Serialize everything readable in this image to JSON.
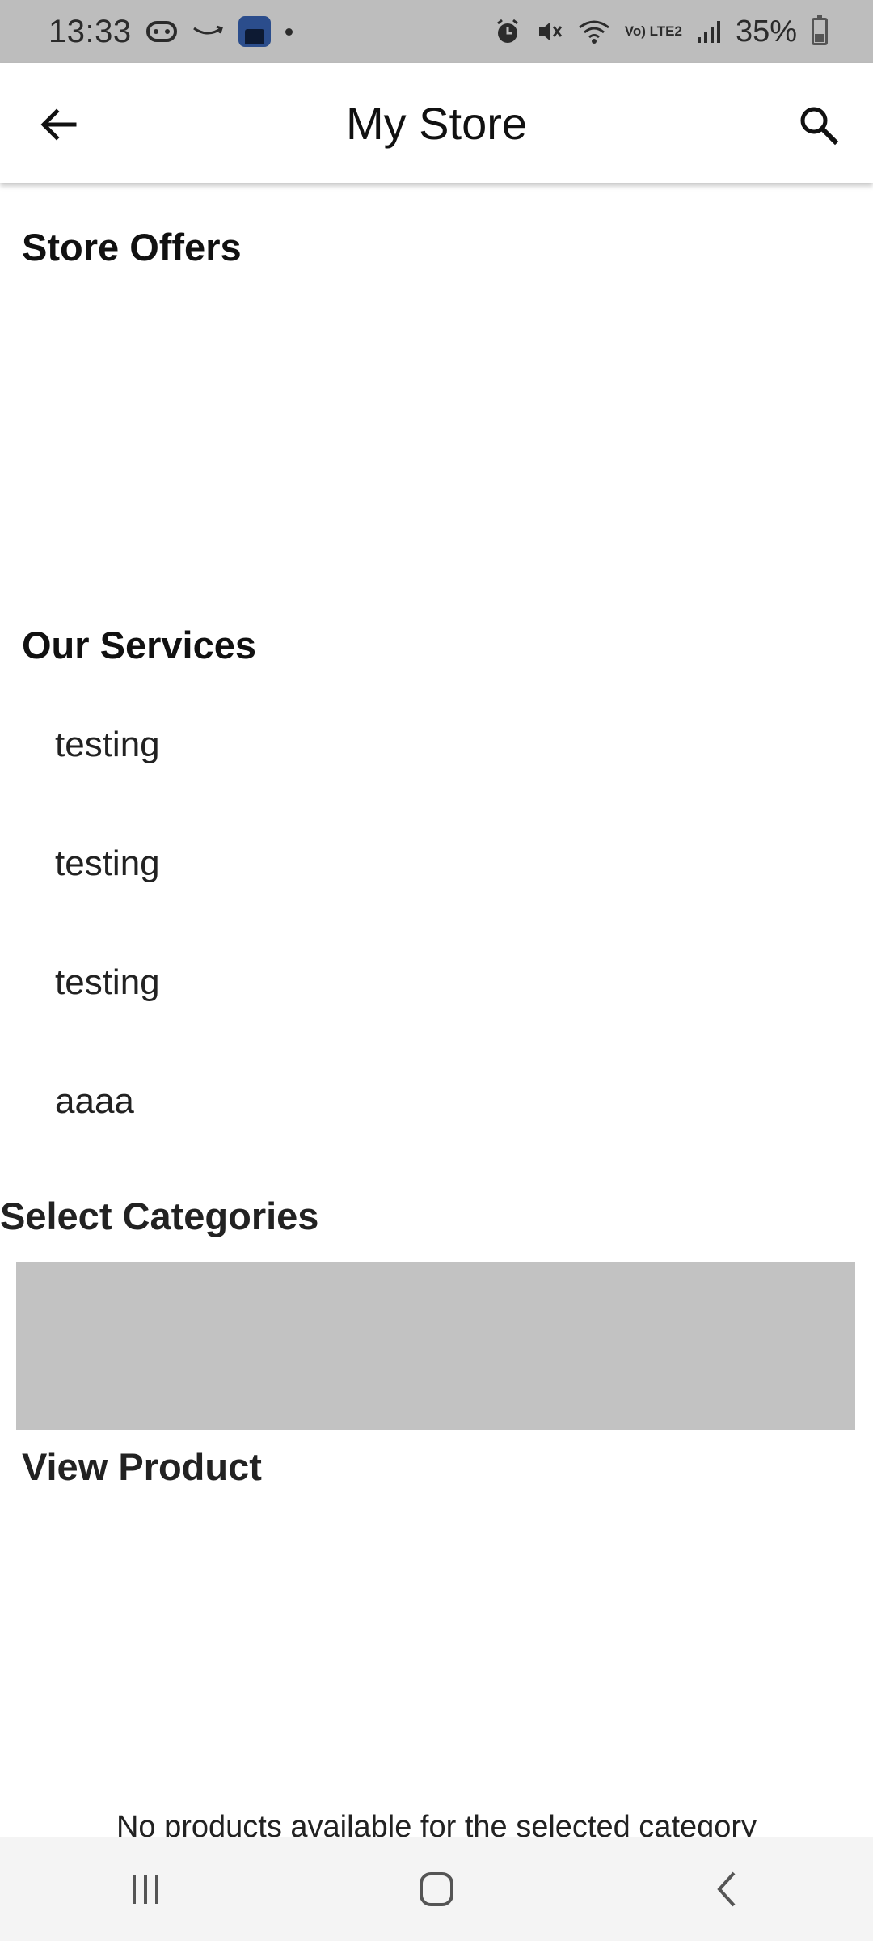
{
  "status_bar": {
    "time": "13:33",
    "battery": "35%",
    "network_label": "Vo) LTE2",
    "battery_level": 0.35,
    "icons": [
      "game-controller-icon",
      "amazon-icon",
      "app-thumbnail-icon",
      "notification-dot",
      "alarm-icon",
      "mute-icon",
      "wifi-icon",
      "volte-lte-icon",
      "signal-icon",
      "battery-icon"
    ]
  },
  "app_bar": {
    "title": "My Store",
    "back_icon": "arrow-back-icon",
    "search_icon": "search-icon"
  },
  "sections": {
    "store_offers": "Store Offers",
    "our_services": "Our Services",
    "select_categories": "Select Categories",
    "view_product": "View Product"
  },
  "services": [
    "testing",
    "testing",
    "testing",
    "aaaa"
  ],
  "products": {
    "empty_message": "No products available for the selected category"
  },
  "colors": {
    "status_bar_bg": "#bdbdbd",
    "placeholder_bg": "#c2c2c2",
    "nav_bar_bg": "#f4f4f4"
  },
  "nav_bar": {
    "items": [
      "recent-apps-icon",
      "home-icon",
      "back-icon"
    ]
  }
}
